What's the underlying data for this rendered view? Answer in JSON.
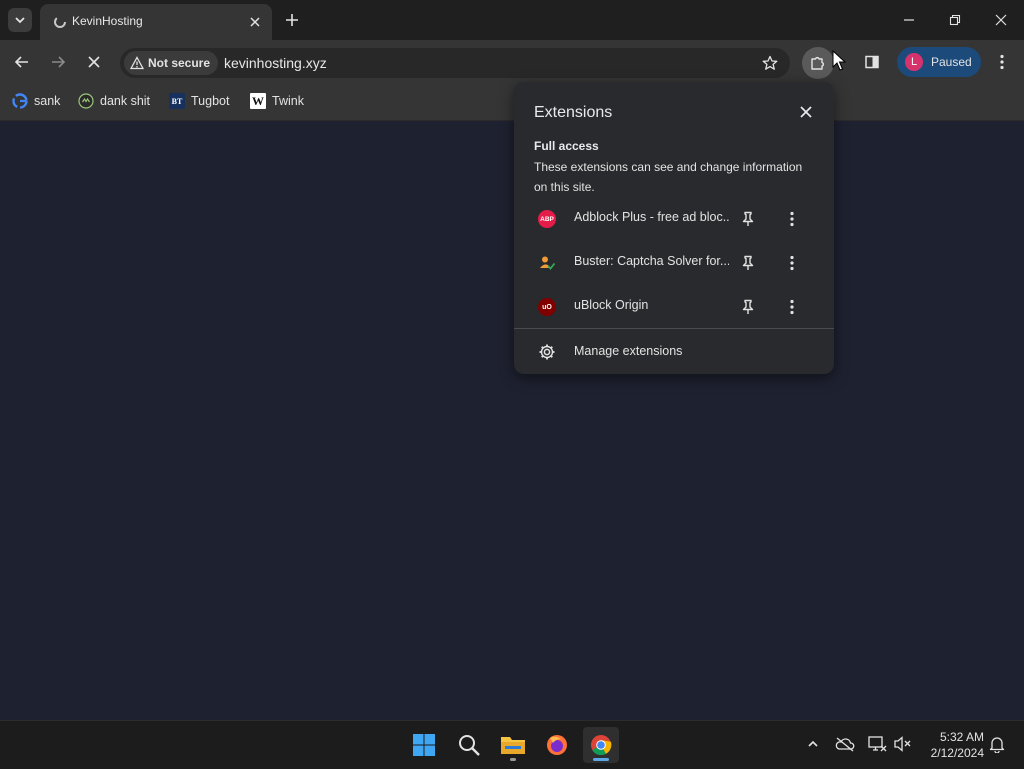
{
  "tab": {
    "title": "KevinHosting"
  },
  "toolbar": {
    "security_label": "Not secure",
    "url": "kevinhosting.xyz",
    "profile_initial": "L",
    "profile_label": "Paused"
  },
  "bookmarks": [
    {
      "label": "sank",
      "icon": "google-icon"
    },
    {
      "label": "dank shit",
      "icon": "bookmark-site-icon"
    },
    {
      "label": "Tugbot",
      "icon": "bt-icon",
      "icon_text": "BT"
    },
    {
      "label": "Twink",
      "icon": "w-icon",
      "icon_text": "W"
    }
  ],
  "extensions_panel": {
    "title": "Extensions",
    "access_heading": "Full access",
    "access_description": "These extensions can see and change information on this site.",
    "items": [
      {
        "name": "Adblock Plus - free ad bloc...",
        "icon": "adblock-plus-icon",
        "icon_text": "ABP",
        "color": "#e41c4a"
      },
      {
        "name": "Buster: Captcha Solver for...",
        "icon": "buster-icon",
        "color": "#f29a38"
      },
      {
        "name": "uBlock Origin",
        "icon": "ublock-origin-icon",
        "icon_text": "uO",
        "color": "#800000"
      }
    ],
    "manage_label": "Manage extensions"
  },
  "taskbar": {
    "time": "5:32 AM",
    "date": "2/12/2024"
  },
  "colors": {
    "page_background": "#1e2130",
    "profile_chip": "#1c4a7a",
    "avatar": "#d6336c",
    "chrome_dark": "#353535"
  }
}
